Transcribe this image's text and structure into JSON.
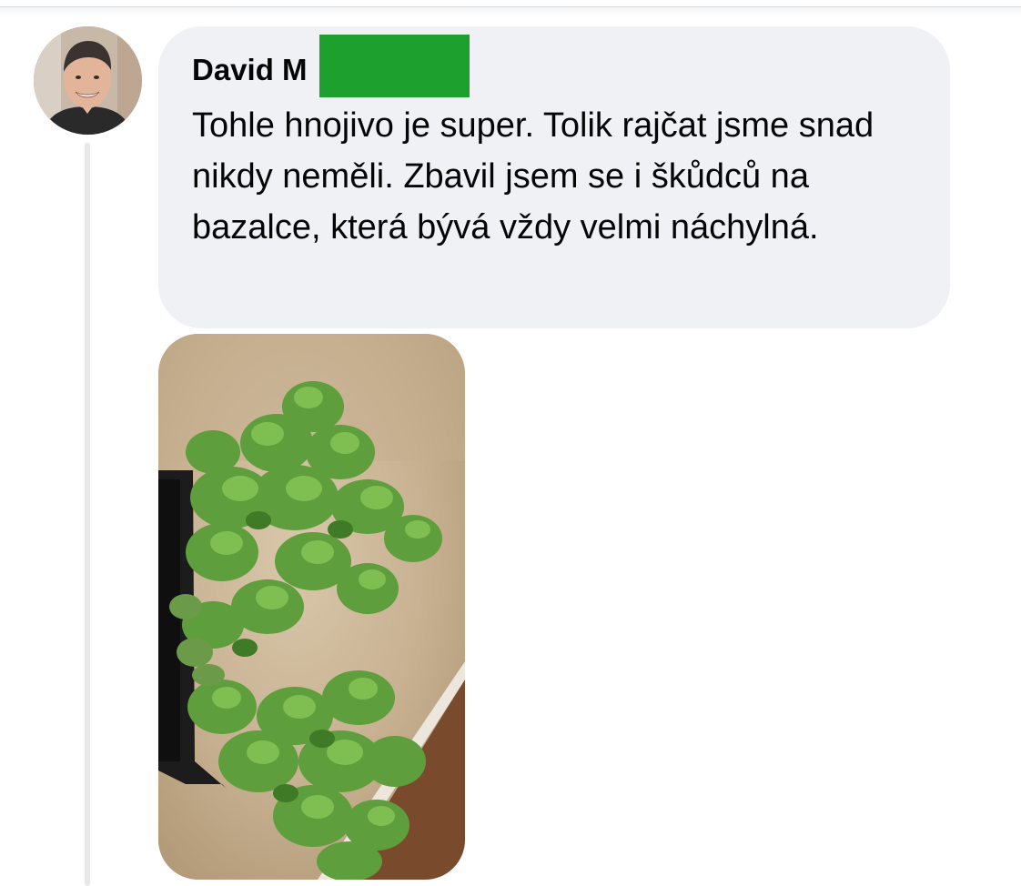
{
  "comment": {
    "author": "David M",
    "text": "Tohle hnojivo je super. Tolik rajčat jsme snad nikdy neměli. Zbavil jsem se i škůdců na bazalce, která bývá vždy velmi náchylná.",
    "redaction_color": "#1ea02e",
    "bubble_color": "#f0f1f5"
  },
  "attachment": {
    "icon": "photo-basil-plants"
  },
  "avatar": {
    "icon": "user-avatar"
  }
}
